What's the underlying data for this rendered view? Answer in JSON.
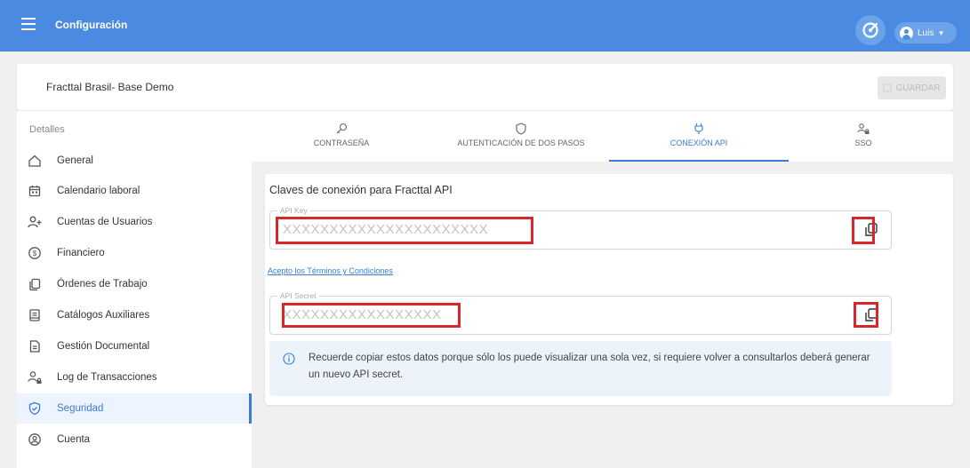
{
  "header": {
    "title": "Configuración",
    "user_name": "Luis"
  },
  "company": {
    "name": "Fracttal Brasil- Base Demo",
    "save_label": "GUARDAR"
  },
  "sidebar": {
    "section_label": "Detalles",
    "items": [
      {
        "label": "General",
        "icon": "home-icon"
      },
      {
        "label": "Calendario laboral",
        "icon": "calendar-icon"
      },
      {
        "label": "Cuentas de Usuarios",
        "icon": "user-add-icon"
      },
      {
        "label": "Financiero",
        "icon": "dollar-icon"
      },
      {
        "label": "Órdenes de Trabajo",
        "icon": "work-orders-icon"
      },
      {
        "label": "Catálogos Auxiliares",
        "icon": "catalog-icon"
      },
      {
        "label": "Gestión Documental",
        "icon": "document-icon"
      },
      {
        "label": "Log de Transacciones",
        "icon": "transactions-log-icon"
      },
      {
        "label": "Seguridad",
        "icon": "shield-icon",
        "active": true
      },
      {
        "label": "Cuenta",
        "icon": "account-icon"
      }
    ]
  },
  "tabs": [
    {
      "label": "CONTRASEÑA",
      "icon": "key-icon"
    },
    {
      "label": "AUTENTICACIÓN DE DOS PASOS",
      "icon": "shield-outline-icon"
    },
    {
      "label": "CONEXIÓN API",
      "icon": "plug-icon",
      "active": true
    },
    {
      "label": "SSO",
      "icon": "user-lock-icon"
    }
  ],
  "api": {
    "heading": "Claves de conexión para Fracttal API",
    "key_label": "API Key",
    "key_value": "XXXXXXXXXXXXXXXXXXXXXX",
    "terms_link": "Acepto los Términos y Condiciones",
    "secret_label": "API Secret",
    "secret_value": "XXXXXXXXXXXXXXXXX",
    "info_text": "Recuerde copiar estos datos porque sólo los puede visualizar una sola vez, si requiere volver a consultarlos deberá generar un nuevo API secret."
  },
  "colors": {
    "primary": "#4a8ae0",
    "accent": "#3a7bd5",
    "highlight": "#d6282c"
  }
}
